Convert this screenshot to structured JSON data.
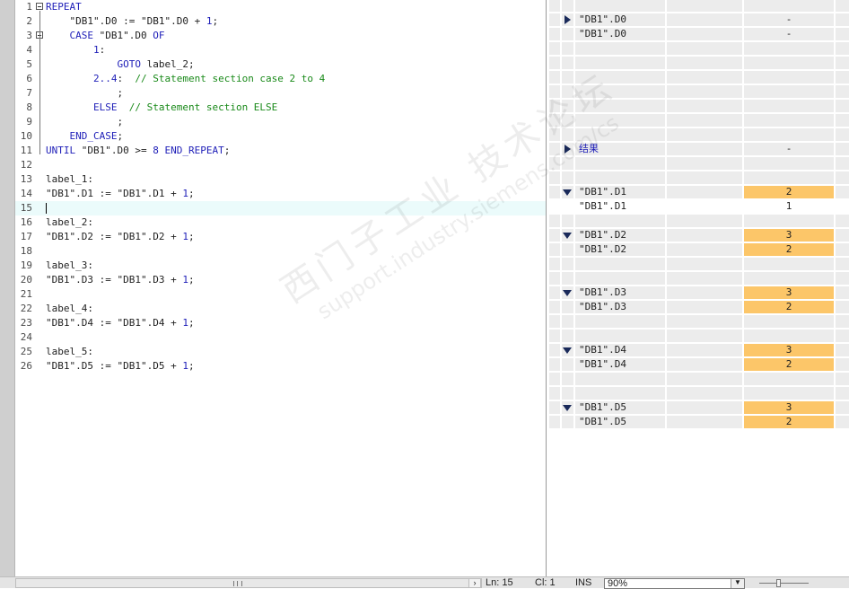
{
  "editor": {
    "lines": [
      {
        "n": "1",
        "code": [
          {
            "t": "REPEAT",
            "c": "kw"
          }
        ],
        "fold": true
      },
      {
        "n": "2",
        "code": [
          {
            "t": "    \"DB1\".D0 := \"DB1\".D0 + "
          },
          {
            "t": "1",
            "c": "num"
          },
          {
            "t": ";"
          }
        ]
      },
      {
        "n": "3",
        "code": [
          {
            "t": "    "
          },
          {
            "t": "CASE",
            "c": "kw"
          },
          {
            "t": " \"DB1\".D0 "
          },
          {
            "t": "OF",
            "c": "kw"
          }
        ],
        "fold": true
      },
      {
        "n": "4",
        "code": [
          {
            "t": "        "
          },
          {
            "t": "1",
            "c": "num"
          },
          {
            "t": ":"
          }
        ]
      },
      {
        "n": "5",
        "code": [
          {
            "t": "            "
          },
          {
            "t": "GOTO",
            "c": "kw"
          },
          {
            "t": " label_2;"
          }
        ]
      },
      {
        "n": "6",
        "code": [
          {
            "t": "        "
          },
          {
            "t": "2..4",
            "c": "num"
          },
          {
            "t": ":  "
          },
          {
            "t": "// Statement section case 2 to 4",
            "c": "cmt"
          }
        ]
      },
      {
        "n": "7",
        "code": [
          {
            "t": "            ;"
          }
        ]
      },
      {
        "n": "8",
        "code": [
          {
            "t": "        "
          },
          {
            "t": "ELSE",
            "c": "kw"
          },
          {
            "t": "  "
          },
          {
            "t": "// Statement section ELSE",
            "c": "cmt"
          }
        ]
      },
      {
        "n": "9",
        "code": [
          {
            "t": "            ;"
          }
        ]
      },
      {
        "n": "10",
        "code": [
          {
            "t": "    "
          },
          {
            "t": "END_CASE",
            "c": "kw"
          },
          {
            "t": ";"
          }
        ]
      },
      {
        "n": "11",
        "code": [
          {
            "t": "UNTIL",
            "c": "kw"
          },
          {
            "t": " \"DB1\".D0 >= "
          },
          {
            "t": "8",
            "c": "num"
          },
          {
            "t": " "
          },
          {
            "t": "END_REPEAT",
            "c": "kw"
          },
          {
            "t": ";"
          }
        ]
      },
      {
        "n": "12",
        "code": []
      },
      {
        "n": "13",
        "code": [
          {
            "t": "label_1:"
          }
        ]
      },
      {
        "n": "14",
        "code": [
          {
            "t": "\"DB1\".D1 := \"DB1\".D1 + "
          },
          {
            "t": "1",
            "c": "num"
          },
          {
            "t": ";"
          }
        ]
      },
      {
        "n": "15",
        "code": [],
        "current": true
      },
      {
        "n": "16",
        "code": [
          {
            "t": "label_2:"
          }
        ]
      },
      {
        "n": "17",
        "code": [
          {
            "t": "\"DB1\".D2 := \"DB1\".D2 + "
          },
          {
            "t": "1",
            "c": "num"
          },
          {
            "t": ";"
          }
        ]
      },
      {
        "n": "18",
        "code": []
      },
      {
        "n": "19",
        "code": [
          {
            "t": "label_3:"
          }
        ]
      },
      {
        "n": "20",
        "code": [
          {
            "t": "\"DB1\".D3 := \"DB1\".D3 + "
          },
          {
            "t": "1",
            "c": "num"
          },
          {
            "t": ";"
          }
        ]
      },
      {
        "n": "21",
        "code": []
      },
      {
        "n": "22",
        "code": [
          {
            "t": "label_4:"
          }
        ]
      },
      {
        "n": "23",
        "code": [
          {
            "t": "\"DB1\".D4 := \"DB1\".D4 + "
          },
          {
            "t": "1",
            "c": "num"
          },
          {
            "t": ";"
          }
        ]
      },
      {
        "n": "24",
        "code": []
      },
      {
        "n": "25",
        "code": [
          {
            "t": "label_5:"
          }
        ]
      },
      {
        "n": "26",
        "code": [
          {
            "t": "\"DB1\".D5 := \"DB1\".D5 + "
          },
          {
            "t": "1",
            "c": "num"
          },
          {
            "t": ";"
          }
        ]
      }
    ]
  },
  "monitor": {
    "rows": [
      {
        "row": 0,
        "name": "",
        "value": ""
      },
      {
        "row": 1,
        "arrow": "right",
        "name": "\"DB1\".D0",
        "value": "-"
      },
      {
        "row": 2,
        "name": "\"DB1\".D0",
        "value": "-"
      },
      {
        "row": 3,
        "name": "",
        "value": ""
      },
      {
        "row": 4,
        "name": "",
        "value": ""
      },
      {
        "row": 5,
        "name": "",
        "value": ""
      },
      {
        "row": 6,
        "name": "",
        "value": ""
      },
      {
        "row": 7,
        "name": "",
        "value": ""
      },
      {
        "row": 8,
        "name": "",
        "value": ""
      },
      {
        "row": 9,
        "name": "",
        "value": ""
      },
      {
        "row": 10,
        "arrow": "right",
        "name": "结果",
        "blue": true,
        "value": "-"
      },
      {
        "row": 11,
        "name": "",
        "value": ""
      },
      {
        "row": 12,
        "name": "",
        "value": ""
      },
      {
        "row": 13,
        "arrow": "down",
        "name": "\"DB1\".D1",
        "value": "2",
        "hot": true
      },
      {
        "row": 14,
        "name": "\"DB1\".D1",
        "value": "1",
        "hot": true,
        "current": true
      },
      {
        "row": 15,
        "name": "",
        "value": ""
      },
      {
        "row": 16,
        "arrow": "down",
        "name": "\"DB1\".D2",
        "value": "3",
        "hot": true
      },
      {
        "row": 17,
        "name": "\"DB1\".D2",
        "value": "2",
        "hot": true
      },
      {
        "row": 18,
        "name": "",
        "value": ""
      },
      {
        "row": 19,
        "name": "",
        "value": ""
      },
      {
        "row": 20,
        "arrow": "down",
        "name": "\"DB1\".D3",
        "value": "3",
        "hot": true
      },
      {
        "row": 21,
        "name": "\"DB1\".D3",
        "value": "2",
        "hot": true
      },
      {
        "row": 22,
        "name": "",
        "value": ""
      },
      {
        "row": 23,
        "name": "",
        "value": ""
      },
      {
        "row": 24,
        "arrow": "down",
        "name": "\"DB1\".D4",
        "value": "3",
        "hot": true
      },
      {
        "row": 25,
        "name": "\"DB1\".D4",
        "value": "2",
        "hot": true
      },
      {
        "row": 26,
        "name": "",
        "value": ""
      },
      {
        "row": 27,
        "name": "",
        "value": ""
      },
      {
        "row": 28,
        "arrow": "down",
        "name": "\"DB1\".D5",
        "value": "3",
        "hot": true
      },
      {
        "row": 29,
        "name": "\"DB1\".D5",
        "value": "2",
        "hot": true
      }
    ]
  },
  "status": {
    "ln": "Ln: 15",
    "cl": "Cl: 1",
    "mode": "INS",
    "zoom": "90%"
  },
  "watermark": {
    "line1": "西门子工业 技术论坛",
    "line2": "support.industry.siemens.com/cs"
  },
  "colors": {
    "keyword": "#1f1fb8",
    "comment": "#1a8a1a",
    "value_highlight": "#fcc669",
    "current_line": "#ebfbfb"
  }
}
